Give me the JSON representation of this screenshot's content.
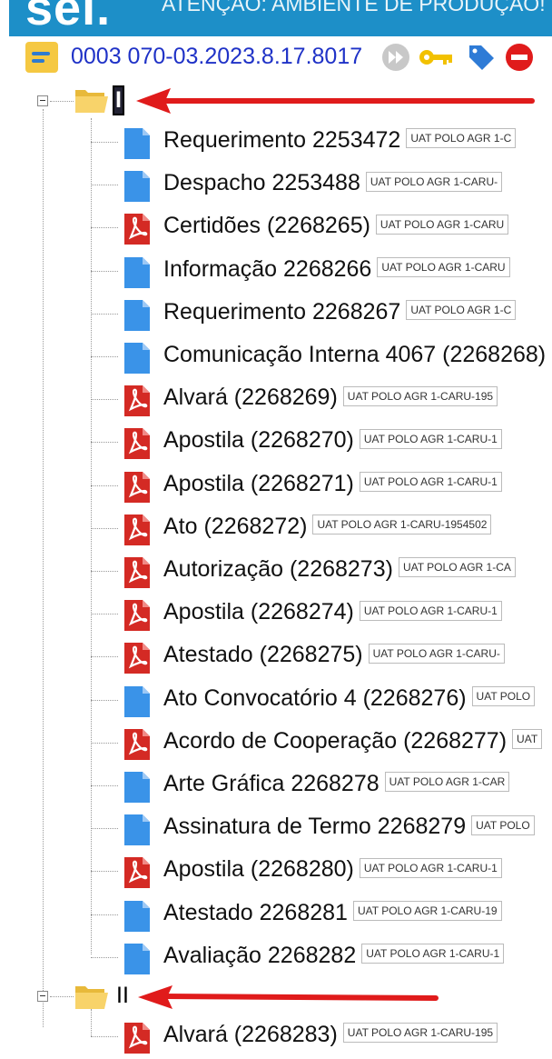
{
  "header": {
    "logo": "sei.",
    "notice": "ATENÇÃO: AMBIENTE DE PRODUÇÃO!"
  },
  "process": {
    "number": "0003 070-03.2023.8.17.8017",
    "actions": [
      "forward-icon",
      "key-icon",
      "tag-icon",
      "block-icon"
    ]
  },
  "folders": [
    {
      "label": "I",
      "expanded": true
    },
    {
      "label": "II",
      "expanded": true
    }
  ],
  "colors": {
    "header": "#1d8fc8",
    "pdf_icon": "#d42a24",
    "doc_icon": "#3a93e8",
    "arrow": "#e01b1b",
    "folder": "#f5c842"
  },
  "documents": [
    {
      "title": "Requerimento 2253472",
      "unit": "UAT POLO AGR 1-C",
      "type": "doc"
    },
    {
      "title": "Despacho 2253488",
      "unit": "UAT POLO AGR 1-CARU-",
      "type": "doc"
    },
    {
      "title": "Certidões (2268265)",
      "unit": "UAT POLO AGR 1-CARU",
      "type": "pdf"
    },
    {
      "title": "Informação 2268266",
      "unit": "UAT POLO AGR 1-CARU",
      "type": "doc"
    },
    {
      "title": "Requerimento 2268267",
      "unit": "UAT POLO AGR 1-C",
      "type": "doc"
    },
    {
      "title": "Comunicação Interna 4067 (2268268)",
      "unit": "",
      "type": "doc"
    },
    {
      "title": "Alvará (2268269)",
      "unit": "UAT POLO AGR 1-CARU-195",
      "type": "pdf"
    },
    {
      "title": "Apostila (2268270)",
      "unit": "UAT POLO AGR 1-CARU-1",
      "type": "pdf"
    },
    {
      "title": "Apostila (2268271)",
      "unit": "UAT POLO AGR 1-CARU-1",
      "type": "pdf"
    },
    {
      "title": "Ato (2268272)",
      "unit": "UAT POLO AGR 1-CARU-1954502",
      "type": "pdf"
    },
    {
      "title": "Autorização (2268273)",
      "unit": "UAT POLO AGR 1-CA",
      "type": "pdf"
    },
    {
      "title": "Apostila (2268274)",
      "unit": "UAT POLO AGR 1-CARU-1",
      "type": "pdf"
    },
    {
      "title": "Atestado (2268275)",
      "unit": "UAT POLO AGR 1-CARU-",
      "type": "pdf"
    },
    {
      "title": "Ato Convocatório 4 (2268276)",
      "unit": "UAT POLO",
      "type": "doc"
    },
    {
      "title": "Acordo de Cooperação (2268277)",
      "unit": "UAT",
      "type": "pdf"
    },
    {
      "title": "Arte Gráfica 2268278",
      "unit": "UAT POLO AGR 1-CAR",
      "type": "doc"
    },
    {
      "title": "Assinatura de Termo 2268279",
      "unit": "UAT POLO",
      "type": "doc"
    },
    {
      "title": "Apostila (2268280)",
      "unit": "UAT POLO AGR 1-CARU-1",
      "type": "pdf"
    },
    {
      "title": "Atestado 2268281",
      "unit": "UAT POLO AGR 1-CARU-19",
      "type": "doc"
    },
    {
      "title": "Avaliação 2268282",
      "unit": "UAT POLO AGR 1-CARU-1",
      "type": "doc"
    }
  ],
  "documents_folder2": [
    {
      "title": "Alvará (2268283)",
      "unit": "UAT POLO AGR 1-CARU-195",
      "type": "pdf"
    }
  ]
}
